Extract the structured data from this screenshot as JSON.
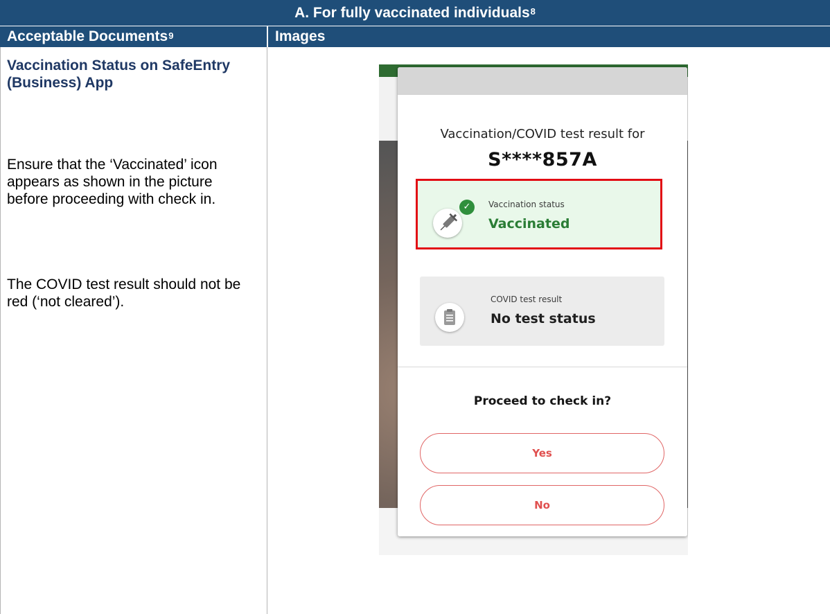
{
  "section": {
    "title": "A.  For fully vaccinated individuals",
    "title_footnote": "8"
  },
  "columns": {
    "documents_header": "Acceptable Documents",
    "documents_footnote": "9",
    "images_header": "Images"
  },
  "row": {
    "heading": "Vaccination Status on SafeEntry (Business) App",
    "instruction_1": "Ensure that the ‘Vaccinated’ icon appears as shown in the picture before proceeding with check in.",
    "instruction_2": "The COVID test result should not be red (‘not cleared’)."
  },
  "screenshot": {
    "dialog_title": "Vaccination/COVID test result for",
    "masked_id": "S****857A",
    "vaccination": {
      "label": "Vaccination status",
      "value": "Vaccinated",
      "icon": "syringe-icon",
      "badge_icon": "check-icon",
      "value_color": "#2a7d35",
      "highlight_color": "#e20d14"
    },
    "covid_test": {
      "label": "COVID test result",
      "value": "No test status",
      "icon": "clipboard-icon"
    },
    "prompt": "Proceed to check in?",
    "yes_label": "Yes",
    "no_label": "No",
    "button_color": "#e0504f"
  },
  "colors": {
    "header_bg": "#1f4e79",
    "heading_text": "#1f3864"
  }
}
